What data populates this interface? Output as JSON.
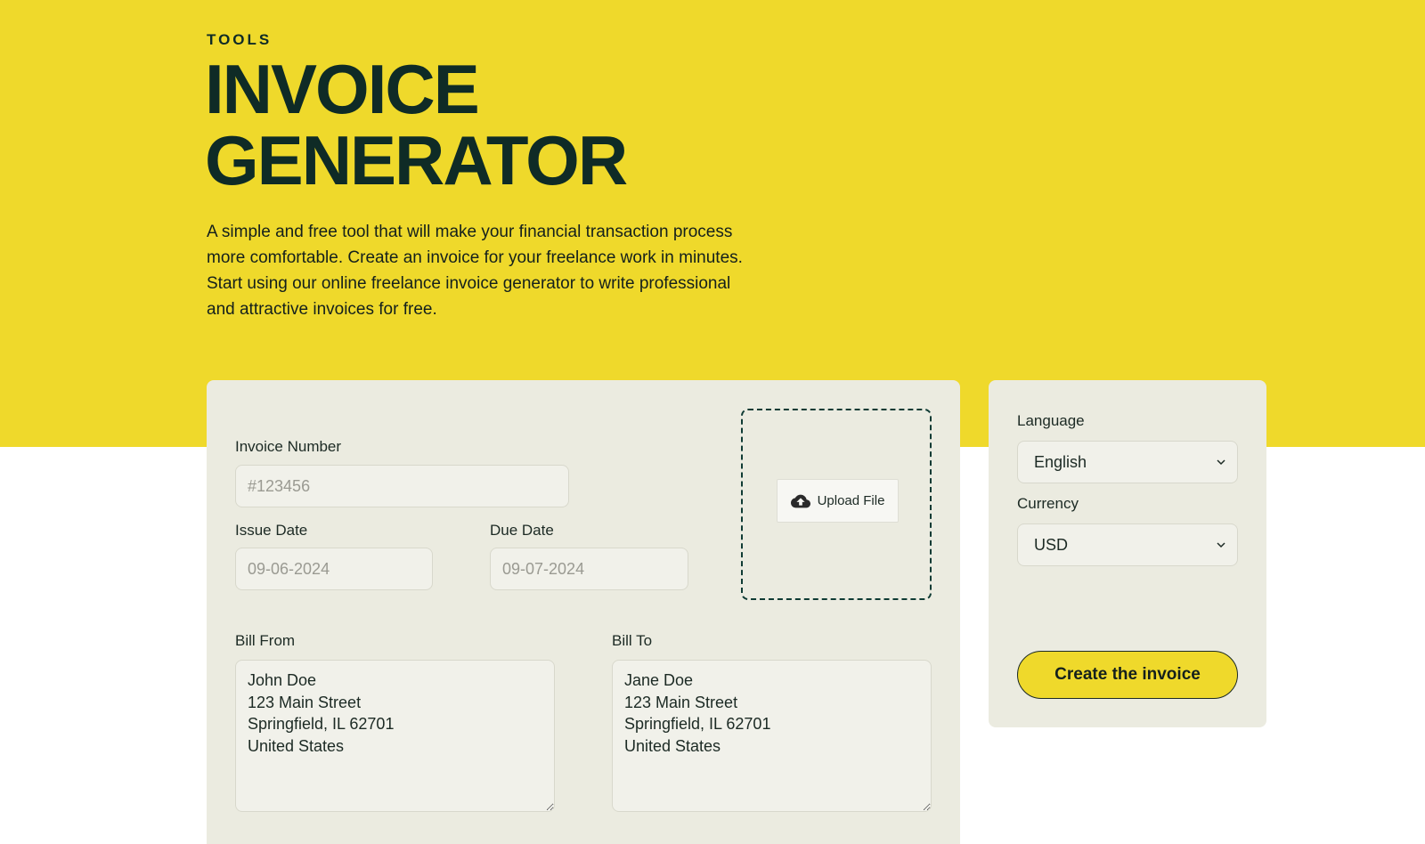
{
  "hero": {
    "eyebrow": "TOOLS",
    "title_line1": "INVOICE",
    "title_line2": "GENERATOR",
    "description": "A simple and free tool that will make your financial transaction process more comfortable. Create an invoice for your freelance work in minutes. Start using our online freelance invoice generator to write professional and attractive invoices for free."
  },
  "form": {
    "invoice_number": {
      "label": "Invoice Number",
      "placeholder": "#123456",
      "value": ""
    },
    "issue_date": {
      "label": "Issue Date",
      "placeholder": "09-06-2024",
      "value": ""
    },
    "due_date": {
      "label": "Due Date",
      "placeholder": "09-07-2024",
      "value": ""
    },
    "upload": {
      "label": "Upload File",
      "icon": "cloud-upload-icon"
    },
    "bill_from": {
      "label": "Bill From",
      "value": "John Doe\n123 Main Street\nSpringfield, IL 62701\nUnited States"
    },
    "bill_to": {
      "label": "Bill To",
      "value": "Jane Doe\n123 Main Street\nSpringfield, IL 62701\nUnited States"
    }
  },
  "settings": {
    "language": {
      "label": "Language",
      "value": "English"
    },
    "currency": {
      "label": "Currency",
      "value": "USD"
    },
    "create_button": "Create the invoice"
  },
  "colors": {
    "brand_yellow": "#efd92b",
    "dark_green": "#0f2b26",
    "panel": "#ebebe0"
  }
}
